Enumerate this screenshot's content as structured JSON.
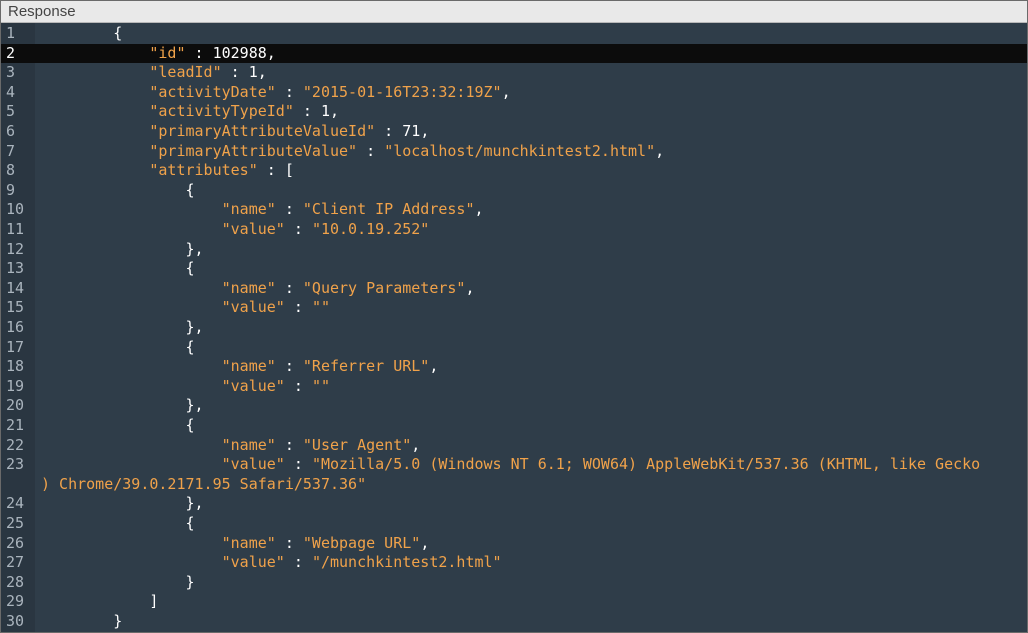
{
  "panel": {
    "title": "Response"
  },
  "editor": {
    "active_line": 2,
    "lines": [
      {
        "num": "1",
        "indent": "        ",
        "tokens": [
          {
            "t": "p",
            "v": "{"
          }
        ]
      },
      {
        "num": "2",
        "indent": "            ",
        "tokens": [
          {
            "t": "k",
            "v": "\"id\""
          },
          {
            "t": "p",
            "v": " : "
          },
          {
            "t": "n",
            "v": "102988"
          },
          {
            "t": "p",
            "v": ","
          }
        ]
      },
      {
        "num": "3",
        "indent": "            ",
        "tokens": [
          {
            "t": "k",
            "v": "\"leadId\""
          },
          {
            "t": "p",
            "v": " : "
          },
          {
            "t": "n",
            "v": "1"
          },
          {
            "t": "p",
            "v": ","
          }
        ]
      },
      {
        "num": "4",
        "indent": "            ",
        "tokens": [
          {
            "t": "k",
            "v": "\"activityDate\""
          },
          {
            "t": "p",
            "v": " : "
          },
          {
            "t": "s",
            "v": "\"2015-01-16T23:32:19Z\""
          },
          {
            "t": "p",
            "v": ","
          }
        ]
      },
      {
        "num": "5",
        "indent": "            ",
        "tokens": [
          {
            "t": "k",
            "v": "\"activityTypeId\""
          },
          {
            "t": "p",
            "v": " : "
          },
          {
            "t": "n",
            "v": "1"
          },
          {
            "t": "p",
            "v": ","
          }
        ]
      },
      {
        "num": "6",
        "indent": "            ",
        "tokens": [
          {
            "t": "k",
            "v": "\"primaryAttributeValueId\""
          },
          {
            "t": "p",
            "v": " : "
          },
          {
            "t": "n",
            "v": "71"
          },
          {
            "t": "p",
            "v": ","
          }
        ]
      },
      {
        "num": "7",
        "indent": "            ",
        "tokens": [
          {
            "t": "k",
            "v": "\"primaryAttributeValue\""
          },
          {
            "t": "p",
            "v": " : "
          },
          {
            "t": "s",
            "v": "\"localhost/munchkintest2.html\""
          },
          {
            "t": "p",
            "v": ","
          }
        ]
      },
      {
        "num": "8",
        "indent": "            ",
        "tokens": [
          {
            "t": "k",
            "v": "\"attributes\""
          },
          {
            "t": "p",
            "v": " : ["
          }
        ]
      },
      {
        "num": "9",
        "indent": "                ",
        "tokens": [
          {
            "t": "p",
            "v": "{"
          }
        ]
      },
      {
        "num": "10",
        "indent": "                    ",
        "tokens": [
          {
            "t": "k",
            "v": "\"name\""
          },
          {
            "t": "p",
            "v": " : "
          },
          {
            "t": "s",
            "v": "\"Client IP Address\""
          },
          {
            "t": "p",
            "v": ","
          }
        ]
      },
      {
        "num": "11",
        "indent": "                    ",
        "tokens": [
          {
            "t": "k",
            "v": "\"value\""
          },
          {
            "t": "p",
            "v": " : "
          },
          {
            "t": "s",
            "v": "\"10.0.19.252\""
          }
        ]
      },
      {
        "num": "12",
        "indent": "                ",
        "tokens": [
          {
            "t": "p",
            "v": "},"
          }
        ]
      },
      {
        "num": "13",
        "indent": "                ",
        "tokens": [
          {
            "t": "p",
            "v": "{"
          }
        ]
      },
      {
        "num": "14",
        "indent": "                    ",
        "tokens": [
          {
            "t": "k",
            "v": "\"name\""
          },
          {
            "t": "p",
            "v": " : "
          },
          {
            "t": "s",
            "v": "\"Query Parameters\""
          },
          {
            "t": "p",
            "v": ","
          }
        ]
      },
      {
        "num": "15",
        "indent": "                    ",
        "tokens": [
          {
            "t": "k",
            "v": "\"value\""
          },
          {
            "t": "p",
            "v": " : "
          },
          {
            "t": "s",
            "v": "\"\""
          }
        ]
      },
      {
        "num": "16",
        "indent": "                ",
        "tokens": [
          {
            "t": "p",
            "v": "},"
          }
        ]
      },
      {
        "num": "17",
        "indent": "                ",
        "tokens": [
          {
            "t": "p",
            "v": "{"
          }
        ]
      },
      {
        "num": "18",
        "indent": "                    ",
        "tokens": [
          {
            "t": "k",
            "v": "\"name\""
          },
          {
            "t": "p",
            "v": " : "
          },
          {
            "t": "s",
            "v": "\"Referrer URL\""
          },
          {
            "t": "p",
            "v": ","
          }
        ]
      },
      {
        "num": "19",
        "indent": "                    ",
        "tokens": [
          {
            "t": "k",
            "v": "\"value\""
          },
          {
            "t": "p",
            "v": " : "
          },
          {
            "t": "s",
            "v": "\"\""
          }
        ]
      },
      {
        "num": "20",
        "indent": "                ",
        "tokens": [
          {
            "t": "p",
            "v": "},"
          }
        ]
      },
      {
        "num": "21",
        "indent": "                ",
        "tokens": [
          {
            "t": "p",
            "v": "{"
          }
        ]
      },
      {
        "num": "22",
        "indent": "                    ",
        "tokens": [
          {
            "t": "k",
            "v": "\"name\""
          },
          {
            "t": "p",
            "v": " : "
          },
          {
            "t": "s",
            "v": "\"User Agent\""
          },
          {
            "t": "p",
            "v": ","
          }
        ]
      },
      {
        "num": "23",
        "indent": "                    ",
        "tokens": [
          {
            "t": "k",
            "v": "\"value\""
          },
          {
            "t": "p",
            "v": " : "
          },
          {
            "t": "s",
            "v": "\"Mozilla/5.0 (Windows NT 6.1; WOW64) AppleWebKit/537.36 (KHTML, like Gecko"
          }
        ]
      },
      {
        "num": "",
        "indent": "",
        "tokens": [
          {
            "t": "s",
            "v": ") Chrome/39.0.2171.95 Safari/537.36\""
          }
        ]
      },
      {
        "num": "24",
        "indent": "                ",
        "tokens": [
          {
            "t": "p",
            "v": "},"
          }
        ]
      },
      {
        "num": "25",
        "indent": "                ",
        "tokens": [
          {
            "t": "p",
            "v": "{"
          }
        ]
      },
      {
        "num": "26",
        "indent": "                    ",
        "tokens": [
          {
            "t": "k",
            "v": "\"name\""
          },
          {
            "t": "p",
            "v": " : "
          },
          {
            "t": "s",
            "v": "\"Webpage URL\""
          },
          {
            "t": "p",
            "v": ","
          }
        ]
      },
      {
        "num": "27",
        "indent": "                    ",
        "tokens": [
          {
            "t": "k",
            "v": "\"value\""
          },
          {
            "t": "p",
            "v": " : "
          },
          {
            "t": "s",
            "v": "\"/munchkintest2.html\""
          }
        ]
      },
      {
        "num": "28",
        "indent": "                ",
        "tokens": [
          {
            "t": "p",
            "v": "}"
          }
        ]
      },
      {
        "num": "29",
        "indent": "            ",
        "tokens": [
          {
            "t": "p",
            "v": "]"
          }
        ]
      },
      {
        "num": "30",
        "indent": "        ",
        "tokens": [
          {
            "t": "p",
            "v": "}"
          }
        ]
      }
    ]
  },
  "colors": {
    "editor_background": "#2f3d49",
    "active_line_background": "#0c0c0c",
    "key_and_string": "#f0a24a",
    "number_and_punctuation": "#ffffff",
    "line_number": "#aab4bd"
  }
}
